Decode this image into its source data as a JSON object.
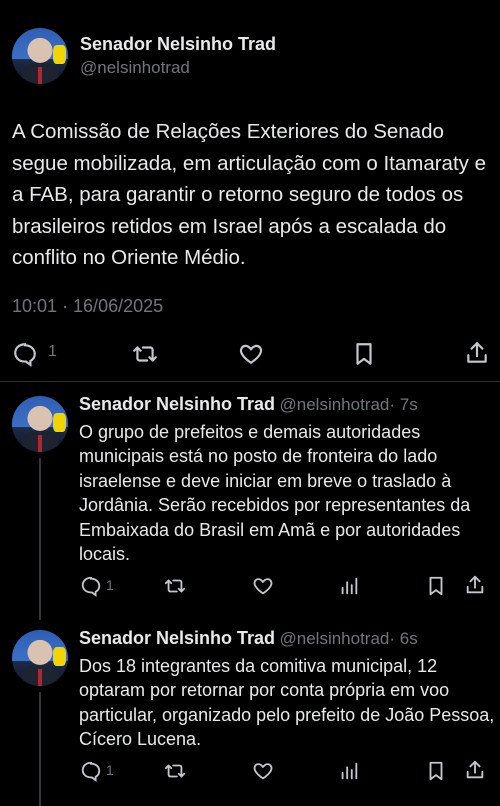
{
  "main_tweet": {
    "author_name": "Senador Nelsinho Trad",
    "author_handle": "@nelsinhotrad",
    "text": "A Comissão de Relações Exteriores do Senado segue mobilizada, em articulação com o Itamaraty e a FAB, para garantir o retorno seguro de todos os brasileiros retidos em Israel após a escalada do conflito no Oriente Médio.",
    "timestamp": "10:01 · 16/06/2025",
    "reply_count": "1",
    "icons": [
      "reply-icon",
      "retweet-icon",
      "like-icon",
      "bookmark-icon",
      "share-icon"
    ]
  },
  "replies": [
    {
      "author_name": "Senador Nelsinho Trad",
      "author_handle": "@nelsinhotrad",
      "time": "· 7s",
      "text": "O grupo de prefeitos e demais autoridades municipais está no posto de fronteira do lado israelense e deve iniciar em breve o traslado à Jordânia. Serão recebidos por representantes da Embaixada do Brasil em Amã e por autoridades locais.",
      "reply_count": "1",
      "icons": [
        "reply-icon",
        "retweet-icon",
        "like-icon",
        "views-icon",
        "bookmark-icon",
        "share-icon"
      ]
    },
    {
      "author_name": "Senador Nelsinho Trad",
      "author_handle": "@nelsinhotrad",
      "time": "· 6s",
      "text": "Dos 18 integrantes da comitiva municipal, 12 optaram por retornar por conta própria em voo particular, organizado pelo prefeito de João Pessoa, Cícero Lucena.",
      "reply_count": "1",
      "icons": [
        "reply-icon",
        "retweet-icon",
        "like-icon",
        "views-icon",
        "bookmark-icon",
        "share-icon"
      ]
    }
  ],
  "colors": {
    "background": "#000000",
    "text_primary": "#e7e9ea",
    "text_secondary": "#71767b",
    "divider": "#2f3336"
  }
}
